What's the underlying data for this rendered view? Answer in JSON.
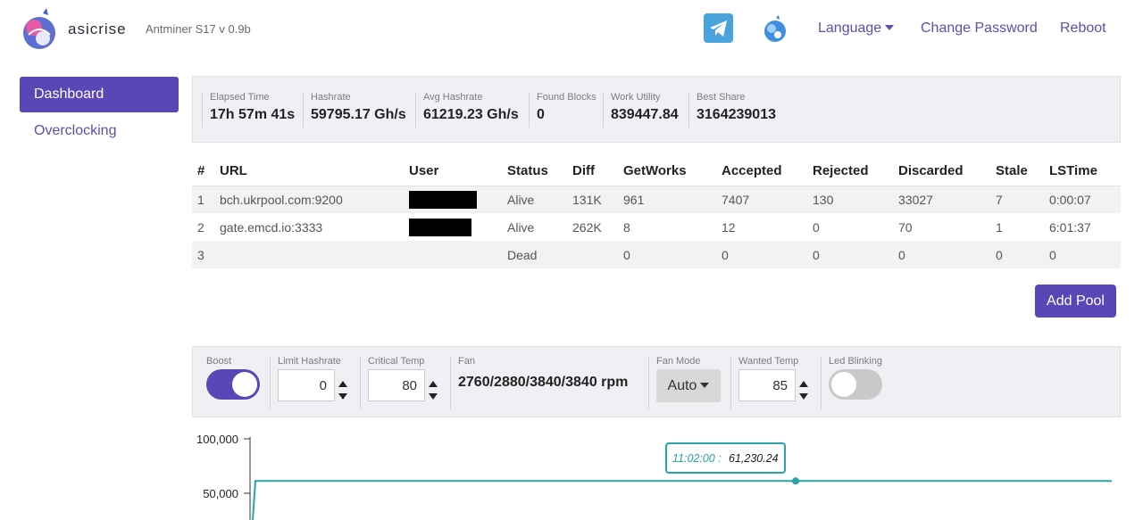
{
  "header": {
    "brand": "asicrise",
    "model": "Antminer S17 v 0.9b",
    "language_label": "Language",
    "change_password_label": "Change Password",
    "reboot_label": "Reboot",
    "accent": "#5b46b6"
  },
  "sidebar": {
    "items": [
      {
        "label": "Dashboard",
        "active": true
      },
      {
        "label": "Overclocking",
        "active": false
      }
    ]
  },
  "stats": [
    {
      "label": "Elapsed Time",
      "value": "17h 57m 41s"
    },
    {
      "label": "Hashrate",
      "value": "59795.17 Gh/s"
    },
    {
      "label": "Avg Hashrate",
      "value": "61219.23 Gh/s"
    },
    {
      "label": "Found Blocks",
      "value": "0"
    },
    {
      "label": "Work Utility",
      "value": "839447.84"
    },
    {
      "label": "Best Share",
      "value": "3164239013"
    }
  ],
  "pools": {
    "columns": [
      "#",
      "URL",
      "User",
      "Status",
      "Diff",
      "GetWorks",
      "Accepted",
      "Rejected",
      "Discarded",
      "Stale",
      "LSTime"
    ],
    "rows": [
      [
        "1",
        "bch.ukrpool.com:9200",
        "",
        "Alive",
        "131K",
        "961",
        "7407",
        "130",
        "33027",
        "7",
        "0:00:07"
      ],
      [
        "2",
        "gate.emcd.io:3333",
        "",
        "Alive",
        "262K",
        "8",
        "12",
        "0",
        "70",
        "1",
        "6:01:37"
      ],
      [
        "3",
        "",
        "",
        "Dead",
        "",
        "0",
        "0",
        "0",
        "0",
        "0",
        "0"
      ]
    ]
  },
  "add_pool_label": "Add Pool",
  "controls": {
    "boost": {
      "label": "Boost",
      "on": true
    },
    "limit_hashrate": {
      "label": "Limit Hashrate",
      "value": "0"
    },
    "critical_temp": {
      "label": "Critical Temp",
      "value": "80"
    },
    "fan": {
      "label": "Fan",
      "value": "2760/2880/3840/3840 rpm"
    },
    "fan_mode": {
      "label": "Fan Mode",
      "value": "Auto"
    },
    "wanted_temp": {
      "label": "Wanted Temp",
      "value": "85"
    },
    "led_blinking": {
      "label": "Led Blinking",
      "on": false
    }
  },
  "chart_data": {
    "type": "line",
    "y_ticks": [
      "100,000",
      "50,000"
    ],
    "tooltip_time": "11:02:00 :",
    "tooltip_value": "61,230.24",
    "series": [
      {
        "values": [
          61230.24,
          61230.24,
          61230.24
        ]
      }
    ],
    "ylim": [
      0,
      100000
    ],
    "line_color": "#2aa3a8"
  }
}
